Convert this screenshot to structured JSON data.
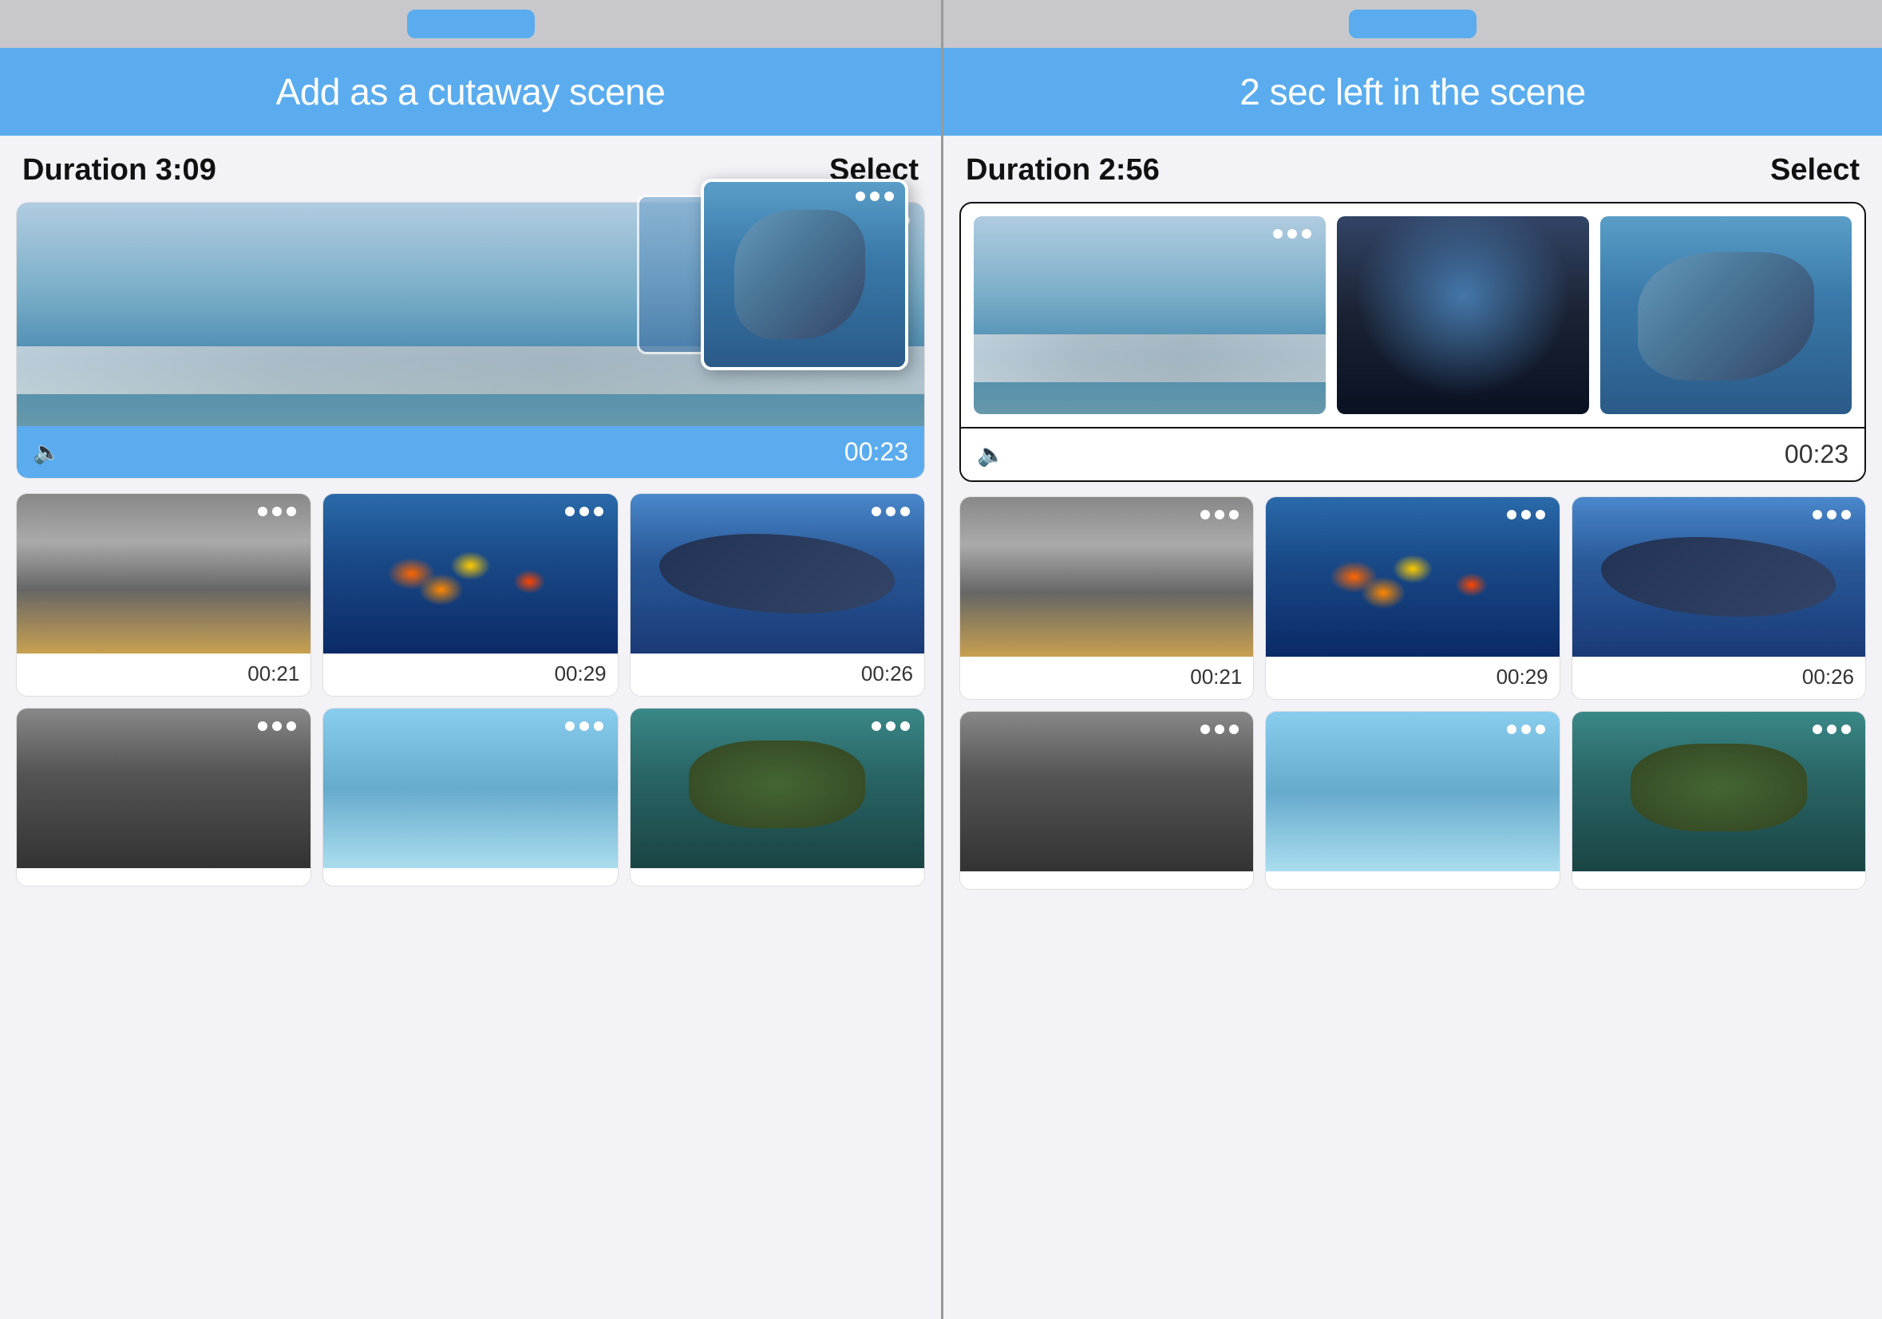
{
  "left_panel": {
    "header": {
      "title": "Add as a cutaway scene"
    },
    "duration": "Duration 3:09",
    "select": "Select",
    "featured": {
      "time": "00:23",
      "has_floating": true
    },
    "grid_row1": [
      {
        "time": "00:21",
        "bg": "puffin"
      },
      {
        "time": "00:29",
        "bg": "tropical"
      },
      {
        "time": "00:26",
        "bg": "whale"
      }
    ],
    "grid_row2": [
      {
        "time": "",
        "bg": "otter"
      },
      {
        "time": "",
        "bg": "lightblue"
      },
      {
        "time": "",
        "bg": "turtle"
      }
    ]
  },
  "right_panel": {
    "header": {
      "title": "2 sec left in the scene"
    },
    "duration": "Duration 2:56",
    "select": "Select",
    "featured": {
      "time": "00:23"
    },
    "grid_row1": [
      {
        "time": "00:21",
        "bg": "puffin"
      },
      {
        "time": "00:29",
        "bg": "tropical"
      },
      {
        "time": "00:26",
        "bg": "whale"
      }
    ],
    "grid_row2": [
      {
        "time": "",
        "bg": "otter"
      },
      {
        "time": "",
        "bg": "lightblue"
      },
      {
        "time": "",
        "bg": "turtle"
      }
    ]
  },
  "colors": {
    "accent": "#5aacee",
    "bg": "#f2f2f7"
  }
}
